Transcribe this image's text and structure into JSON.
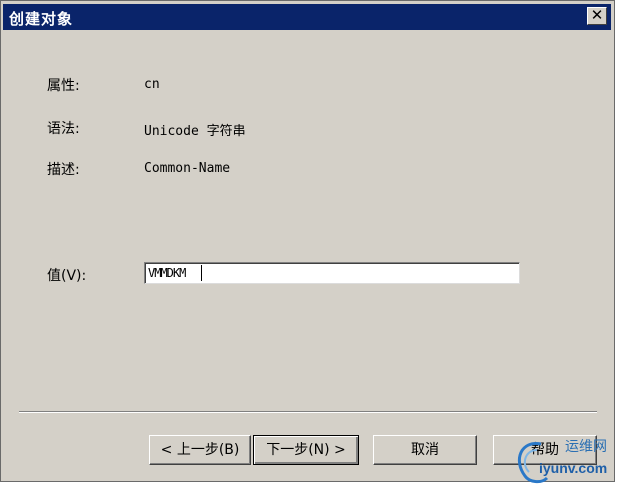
{
  "window": {
    "title": "创建对象",
    "close_glyph": "✕"
  },
  "fields": {
    "attribute_label": "属性:",
    "attribute_value": "cn",
    "syntax_label": "语法:",
    "syntax_value": "Unicode 字符串",
    "description_label": "描述:",
    "description_value": "Common-Name",
    "value_label": "值(V):",
    "value_input": "VMMDKM"
  },
  "buttons": {
    "back": "< 上一步(B)",
    "next": "下一步(N) >",
    "cancel": "取消",
    "help": "帮助"
  },
  "watermark": {
    "cn": "运维网",
    "domain": "iyunv.com"
  }
}
